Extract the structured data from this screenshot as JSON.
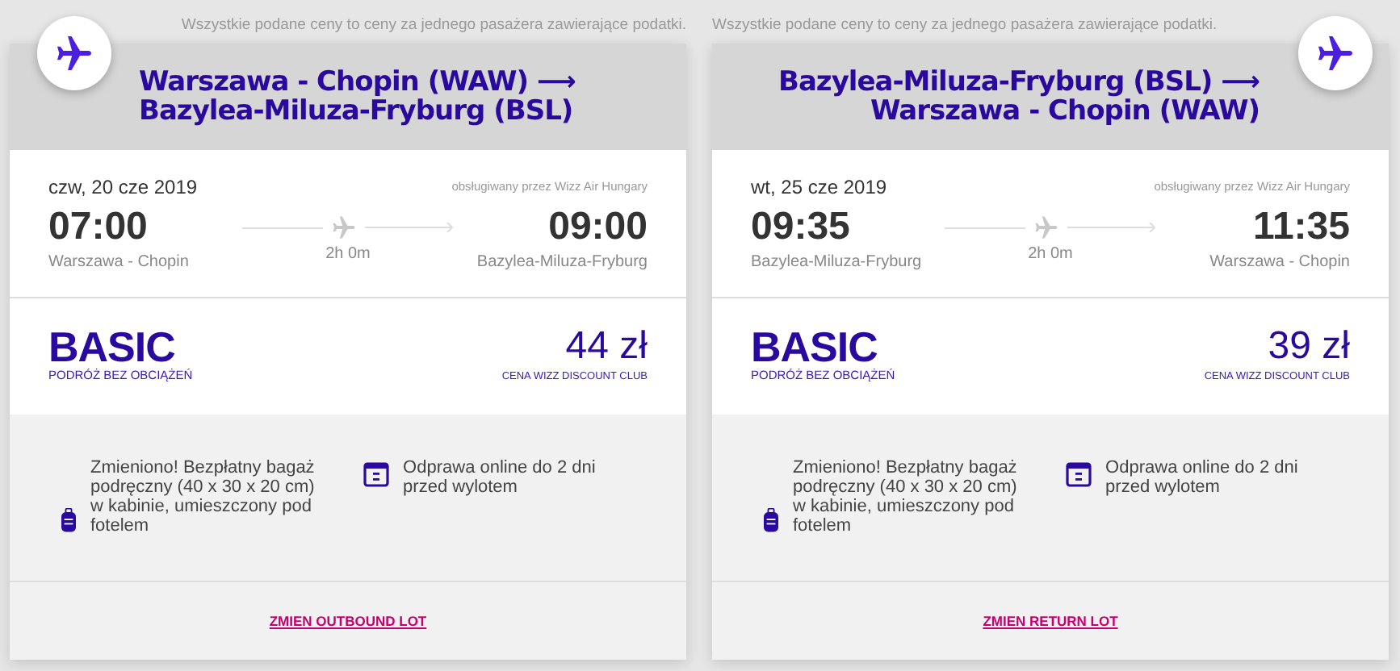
{
  "cards": [
    {
      "kind": "outbound",
      "note": "Wszystkie podane ceny to ceny za jednego pasażera zawierające podatki.",
      "route_from": "Warszawa - Chopin (WAW)",
      "route_arrow": "⟶",
      "route_to": "Bazylea-Miluza-Fryburg (BSL)",
      "date": "czw, 20 cze 2019",
      "operator": "obsługiwany przez Wizz Air Hungary",
      "departure_time": "07:00",
      "departure_airport": "Warszawa - Chopin",
      "duration": "2h 0m",
      "arrival_time": "09:00",
      "arrival_airport": "Bazylea-Miluza-Fryburg",
      "fare_name": "BASIC",
      "fare_subtitle": "PODRÓŻ BEZ OBCIĄŻEŃ",
      "price": "44 zł",
      "price_label": "CENA WIZZ DISCOUNT CLUB",
      "features": [
        {
          "kind": "bag",
          "text": "Zmieniono! Bezpłatny bagaż podręczny (40 x 30 x 20 cm) w kabinie, umieszczony pod fotelem"
        },
        {
          "kind": "calendar",
          "text": "Odprawa online do 2 dni przed wylotem"
        }
      ],
      "change_link": "ZMIEN OUTBOUND LOT"
    },
    {
      "kind": "return",
      "note": "Wszystkie podane ceny to ceny za jednego pasażera zawierające podatki.",
      "route_from": "Bazylea-Miluza-Fryburg (BSL)",
      "route_arrow": "⟶",
      "route_to": "Warszawa - Chopin (WAW)",
      "date": "wt, 25 cze 2019",
      "operator": "obsługiwany przez Wizz Air Hungary",
      "departure_time": "09:35",
      "departure_airport": "Bazylea-Miluza-Fryburg",
      "duration": "2h 0m",
      "arrival_time": "11:35",
      "arrival_airport": "Warszawa - Chopin",
      "fare_name": "BASIC",
      "fare_subtitle": "PODRÓŻ BEZ OBCIĄŻEŃ",
      "price": "39 zł",
      "price_label": "CENA WIZZ DISCOUNT CLUB",
      "features": [
        {
          "kind": "bag",
          "text": "Zmieniono! Bezpłatny bagaż podręczny (40 x 30 x 20 cm) w kabinie, umieszczony pod fotelem"
        },
        {
          "kind": "calendar",
          "text": "Odprawa online do 2 dni przed wylotem"
        }
      ],
      "change_link": "ZMIEN RETURN LOT"
    }
  ]
}
